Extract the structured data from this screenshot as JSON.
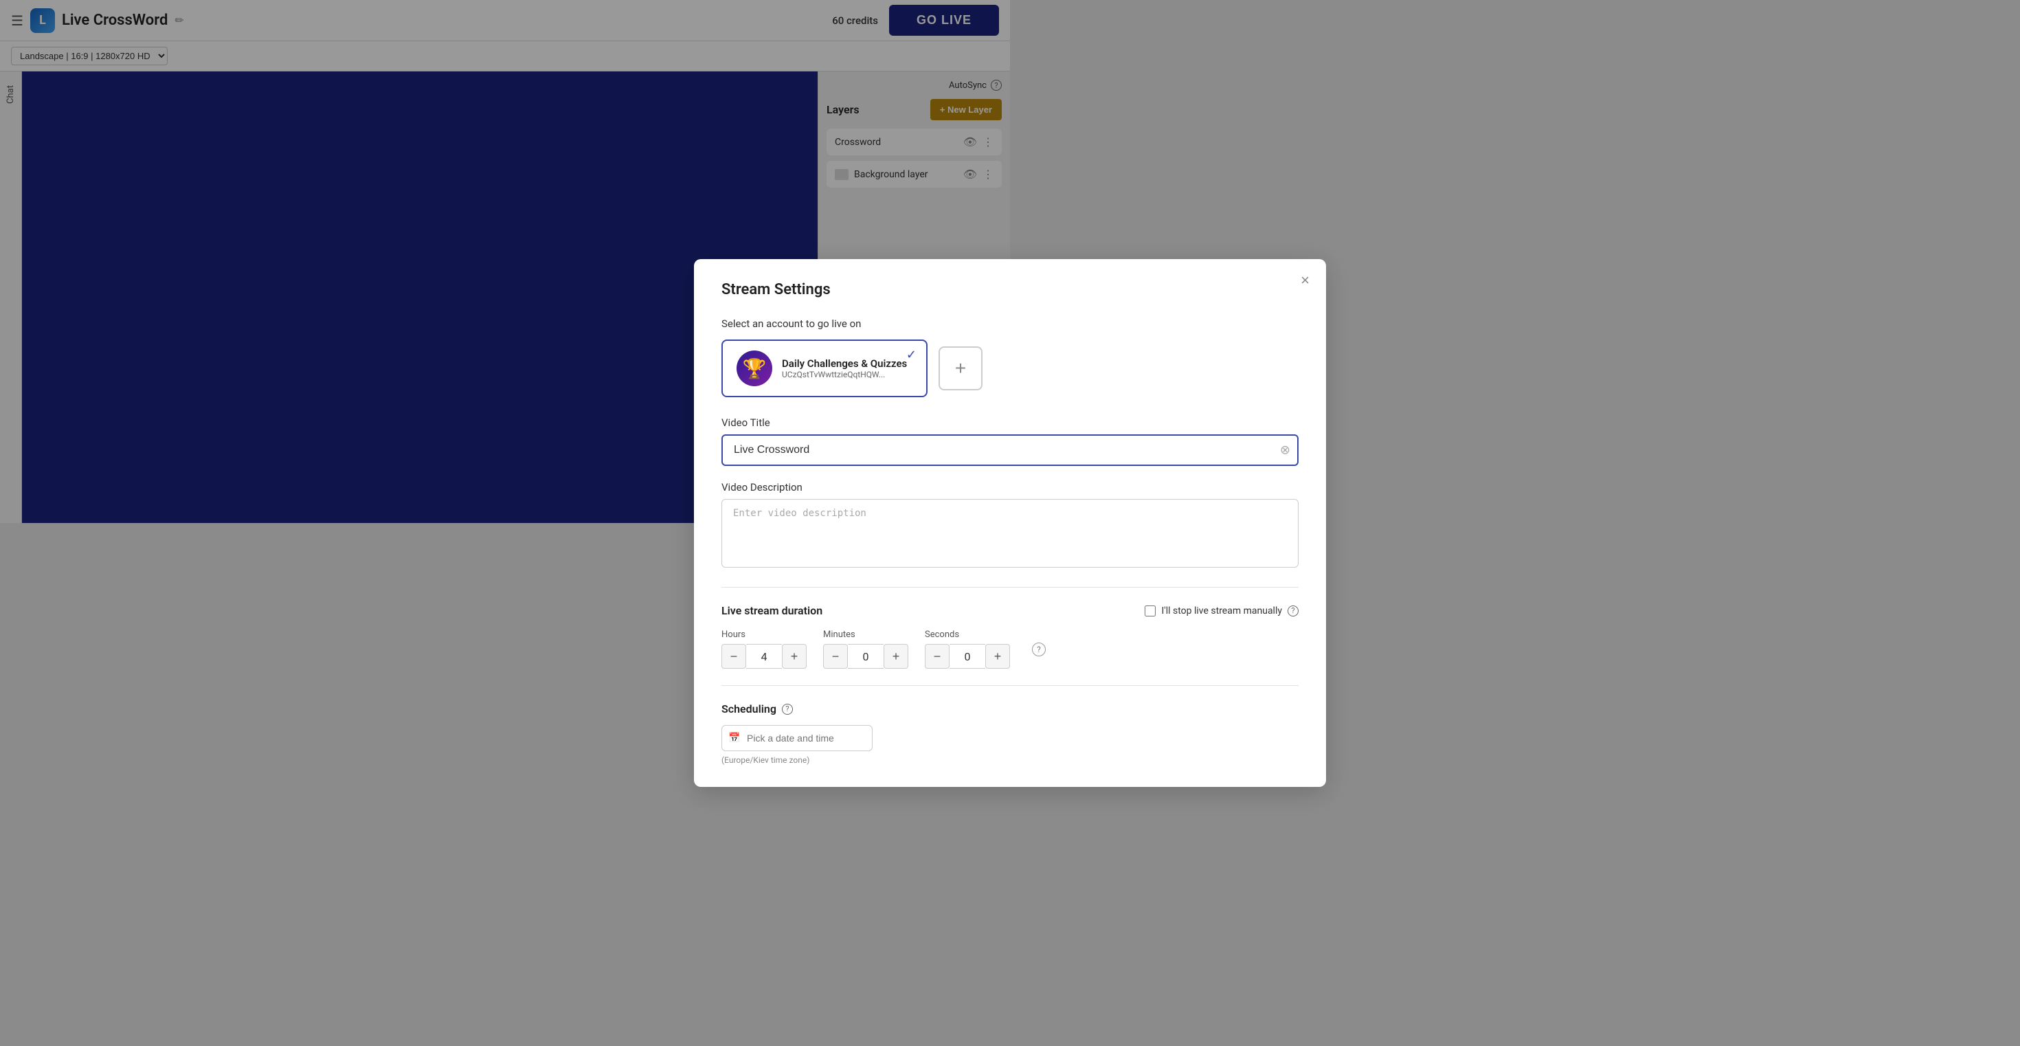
{
  "topbar": {
    "hamburger": "☰",
    "logo_letter": "L",
    "title": "Live CrossWord",
    "credits": "60 credits",
    "go_live_label": "GO LIVE"
  },
  "subbar": {
    "resolution": "Landscape | 16:9 | 1280x720 HD"
  },
  "sidebar": {
    "chat_label": "Chat"
  },
  "right_panel": {
    "autosync_label": "AutoSync",
    "layers_title": "Layers",
    "new_layer_label": "+ New Layer",
    "layers": [
      {
        "name": "Crossword",
        "type": "layer"
      },
      {
        "name": "Background layer",
        "type": "background"
      }
    ]
  },
  "modal": {
    "title": "Stream Settings",
    "close_label": "×",
    "select_account_label": "Select an account to go live on",
    "account": {
      "name": "Daily Challenges & Quizzes",
      "id": "UCzQstTvWwttzie​QqtHQW...",
      "avatar_emoji": "🏆"
    },
    "add_account_label": "+",
    "video_title_label": "Video Title",
    "video_title_value": "Live Crossword",
    "video_title_placeholder": "Live Crossword",
    "video_title_clear": "⊗",
    "video_desc_label": "Video Description",
    "video_desc_placeholder": "Enter video description",
    "duration_title": "Live stream duration",
    "manual_stop_label": "I'll stop live stream manually",
    "hours_label": "Hours",
    "minutes_label": "Minutes",
    "seconds_label": "Seconds",
    "hours_value": "4",
    "minutes_value": "0",
    "seconds_value": "0",
    "scheduling_title": "Scheduling",
    "date_placeholder": "Pick a date and time",
    "timezone_note": "(Europe/Kiev time zone)"
  },
  "icons": {
    "minus": "−",
    "plus": "+",
    "eye": "👁",
    "dots": "⋮",
    "calendar": "📅",
    "help": "?",
    "check": "✓",
    "pencil": "✏"
  }
}
